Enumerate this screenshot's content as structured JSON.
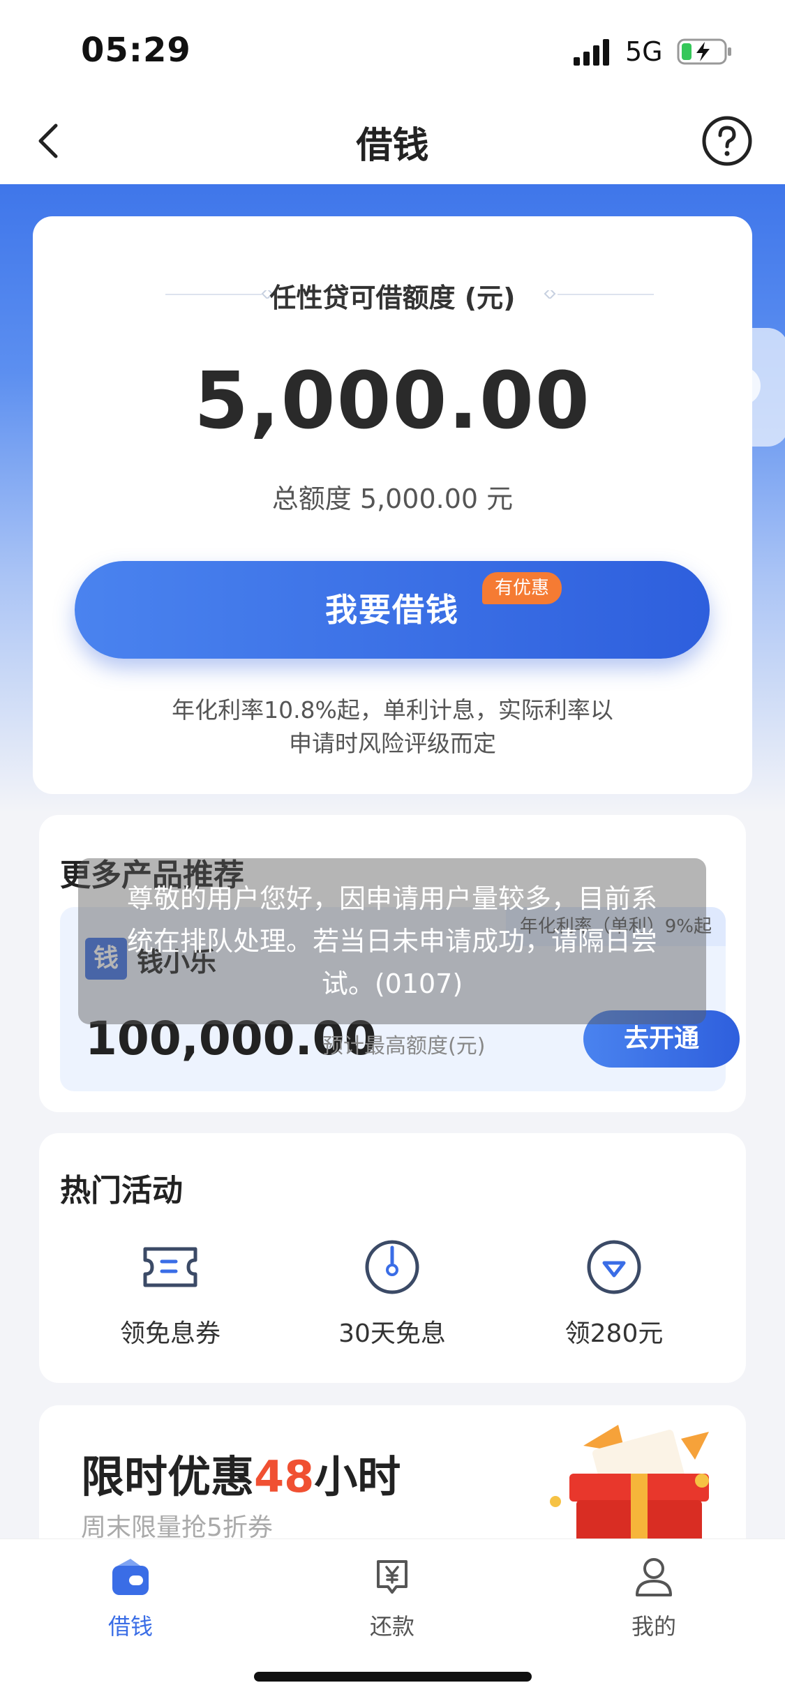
{
  "status_bar": {
    "time": "05:29",
    "network": "5G"
  },
  "nav": {
    "title": "借钱"
  },
  "credit": {
    "label": "任性贷可借额度 (元)",
    "amount": "5,000.00",
    "total": "总额度 5,000.00 元",
    "borrow_button": "我要借钱",
    "badge": "有优惠",
    "rate_note_line1": "年化利率10.8%起，单利计息，实际利率以",
    "rate_note_line2": "申请时风险评级而定"
  },
  "more_products": {
    "title": "更多产品推荐",
    "product": {
      "logo": "钱",
      "name": "钱小乐",
      "rate_tag": "年化利率（单利）9%起",
      "amount": "100,000.00",
      "amount_label": "预计最高额度(元)",
      "open_button": "去开通"
    }
  },
  "toast": {
    "line1": "尊敬的用户您好，因申请用户量较多，目前系",
    "line2": "统在排队处理。若当日未申请成功，请隔日尝",
    "line3": "试。(0107)"
  },
  "activities": {
    "title": "热门活动",
    "items": [
      {
        "label": "领免息券",
        "icon": "coupon-icon"
      },
      {
        "label": "30天免息",
        "icon": "clock-icon"
      },
      {
        "label": "领280元",
        "icon": "heart-badge-icon"
      }
    ]
  },
  "promo": {
    "title_prefix": "限时优惠",
    "title_highlight": "48",
    "title_suffix": "小时",
    "subtitle": "周末限量抢5折券",
    "carousel_total": 3,
    "carousel_active": 3
  },
  "tabs": [
    {
      "label": "借钱",
      "icon": "wallet-icon",
      "active": true
    },
    {
      "label": "还款",
      "icon": "repay-icon",
      "active": false
    },
    {
      "label": "我的",
      "icon": "user-icon",
      "active": false
    }
  ],
  "colors": {
    "primary": "#3a6de6",
    "accent_orange": "#f57b33",
    "highlight_red": "#f05032"
  }
}
